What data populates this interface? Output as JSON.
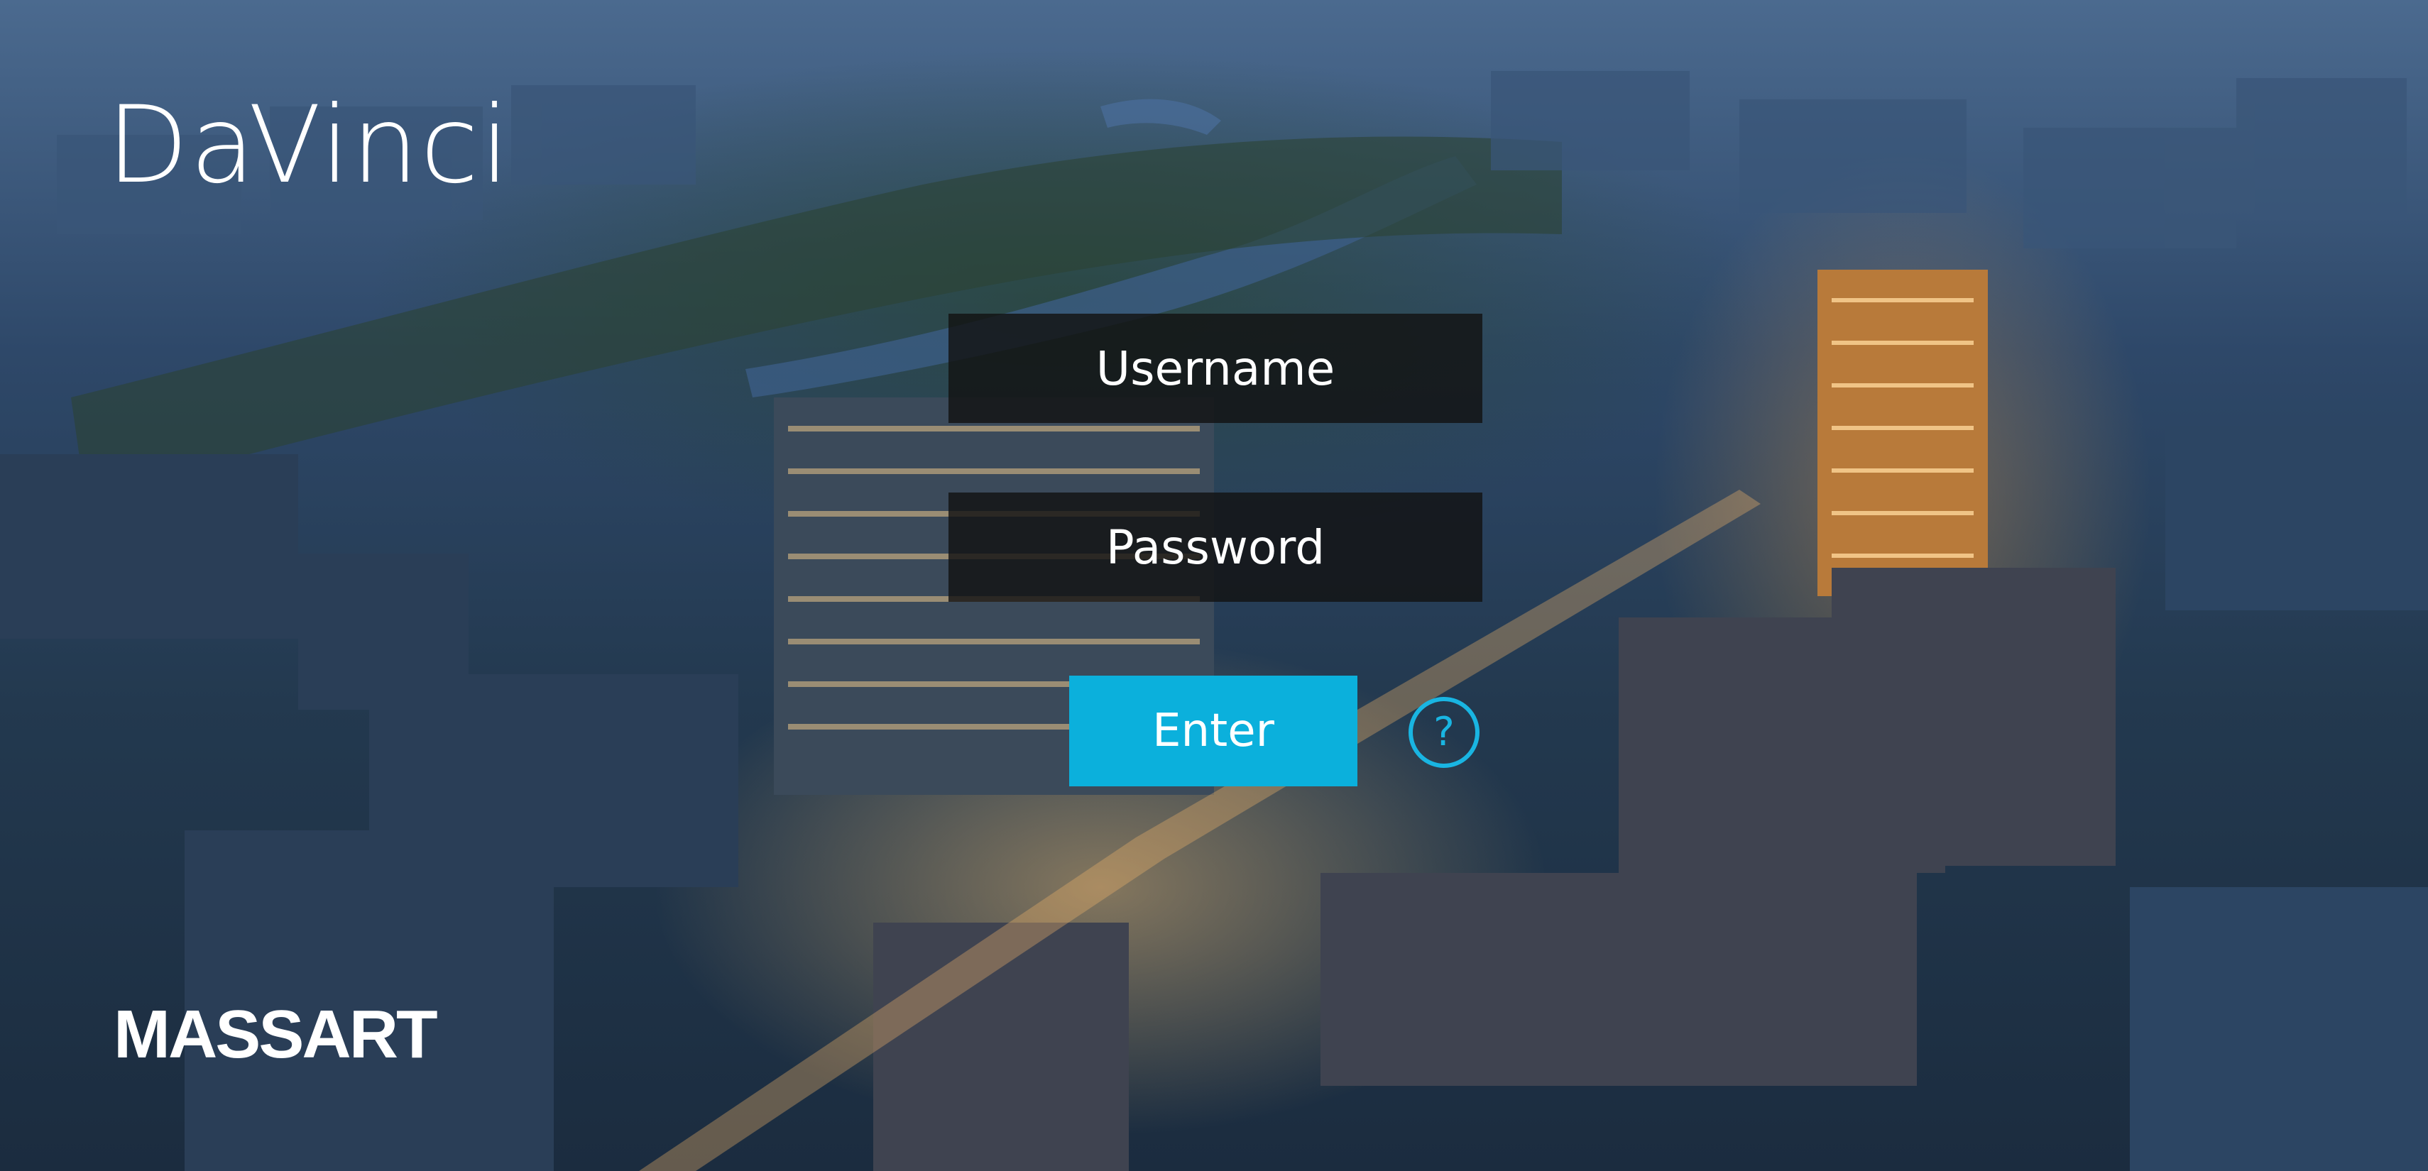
{
  "brand": {
    "app_name": "DaVinci",
    "school_logo": "MASSART"
  },
  "login": {
    "username_placeholder": "Username",
    "password_placeholder": "Password",
    "enter_label": "Enter",
    "help_label": "?"
  },
  "colors": {
    "accent": "#0bb0dc",
    "field_background": "#121212"
  },
  "icons": {
    "help": "question-circle-icon"
  }
}
